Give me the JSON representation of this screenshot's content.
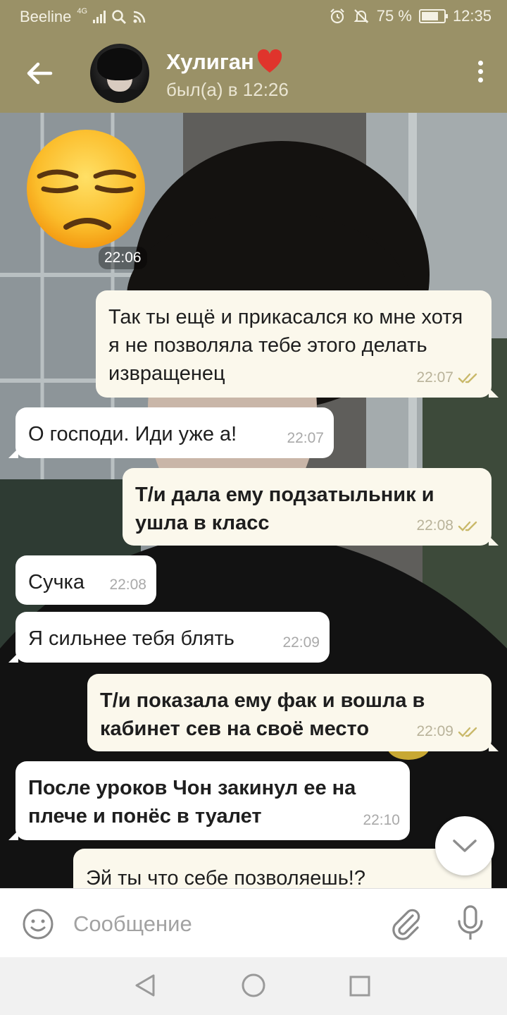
{
  "status_bar": {
    "carrier": "Beeline",
    "network": "4G",
    "battery": "75 %",
    "battery_level": 0.75,
    "time": "12:35",
    "icons": [
      "signal-icon",
      "search-icon",
      "cast-icon",
      "alarm-icon",
      "mute-icon",
      "battery-icon"
    ]
  },
  "header": {
    "title": "Хулиган",
    "title_emoji": "heart-icon",
    "subtitle": "был(а) в 12:26",
    "accent_color": "#9a9167"
  },
  "sticker": {
    "icon": "unamused-face-sticker",
    "time": "22:06"
  },
  "messages": [
    {
      "dir": "out",
      "text": "Так ты ещё и прикасался ко мне хотя я не позволяла тебе этого делать извращенец",
      "time": "22:07",
      "read": true
    },
    {
      "dir": "in",
      "text": "О господи. Иди уже а!",
      "time": "22:07"
    },
    {
      "dir": "out",
      "text": "Т/и дала ему подзатыльник и ушла в класс",
      "time": "22:08",
      "read": true
    },
    {
      "dir": "in",
      "text": "Сучка",
      "time": "22:08"
    },
    {
      "dir": "in",
      "text": "Я сильнее тебя блять",
      "time": "22:09"
    },
    {
      "dir": "out",
      "text": "Т/и показала ему фак и вошла в кабинет сев на своё место",
      "time": "22:09",
      "read": true
    },
    {
      "dir": "in",
      "text": "После уроков Чон закинул ее на плече и понёс в туалет",
      "time": "22:10"
    },
    {
      "dir": "out",
      "text": "Эй ты что себе позволяешь!?",
      "time": ""
    }
  ],
  "input": {
    "placeholder": "Сообщение"
  },
  "colors": {
    "incoming_bubble": "#ffffff",
    "outgoing_bubble": "#fbf8ec",
    "read_check": "#c9b96a"
  }
}
